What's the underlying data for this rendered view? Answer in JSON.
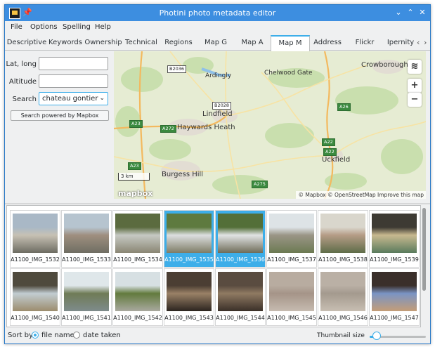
{
  "window": {
    "title": "Photini photo metadata editor",
    "pin_glyph": "📌",
    "minimize": "⌄",
    "maximize": "⌃",
    "close": "✕"
  },
  "menu": [
    "File",
    "Options",
    "Spelling",
    "Help"
  ],
  "tabs": [
    "Descriptive",
    "Keywords",
    "Ownership",
    "Technical",
    "Regions",
    "Map G",
    "Map A",
    "Map M",
    "Address",
    "Flickr",
    "Ipernity"
  ],
  "active_tab": "Map M",
  "tab_scroll": {
    "left": "‹",
    "right": "›"
  },
  "form": {
    "latlong_label": "Lat, long",
    "latlong_value": "",
    "altitude_label": "Altitude",
    "altitude_value": "",
    "search_label": "Search",
    "search_value": "chateau gontier",
    "search_arrow": "⌄",
    "search_button": "Search powered by Mapbox"
  },
  "map": {
    "places": [
      "Crowborough",
      "Ardingly",
      "Chelwood Gate",
      "Lindfield",
      "Haywards Heath",
      "Uckfield",
      "Burgess Hill"
    ],
    "roads": [
      "B2036",
      "B2028",
      "A26",
      "A23",
      "A272",
      "A22",
      "A22",
      "A23",
      "A275"
    ],
    "scale": "3 km",
    "logo": "mapbox",
    "attribution": "© Mapbox © OpenStreetMap Improve this map",
    "zoom_in": "+",
    "zoom_out": "−",
    "layers_icon": "≋"
  },
  "thumbnails": [
    {
      "name": "A1100_IMG_1532",
      "selected": false,
      "c1": "#a9b8c6",
      "c2": "#c7c1b4",
      "c3": "#6d6c62"
    },
    {
      "name": "A1100_IMG_1533",
      "selected": false,
      "c1": "#b6c4cf",
      "c2": "#9f8f7f",
      "c3": "#6f6e63"
    },
    {
      "name": "A1100_IMG_1534",
      "selected": false,
      "c1": "#5b6b3f",
      "c2": "#c6c9c3",
      "c3": "#8a8674"
    },
    {
      "name": "A1100_IMG_1535",
      "selected": true,
      "c1": "#5e7a3f",
      "c2": "#dcdfe0",
      "c3": "#7e7c66"
    },
    {
      "name": "A1100_IMG_1536",
      "selected": true,
      "c1": "#536f38",
      "c2": "#e1e3e4",
      "c3": "#6f6d59"
    },
    {
      "name": "A1100_IMG_1537",
      "selected": false,
      "c1": "#dde3e6",
      "c2": "#9a9586",
      "c3": "#6c7a52"
    },
    {
      "name": "A1100_IMG_1538",
      "selected": false,
      "c1": "#d9d6cc",
      "c2": "#b59c86",
      "c3": "#5f6d49"
    },
    {
      "name": "A1100_IMG_1539",
      "selected": false,
      "c1": "#3d3a33",
      "c2": "#c8b98f",
      "c3": "#5a7b5d"
    },
    {
      "name": "A1100_IMG_1540",
      "selected": false,
      "c1": "#4f4a3d",
      "c2": "#c2cdd2",
      "c3": "#9c8c6d"
    },
    {
      "name": "A1100_IMG_1541",
      "selected": false,
      "c1": "#dfe7ea",
      "c2": "#6f7b56",
      "c3": "#7e8b8c"
    },
    {
      "name": "A1100_IMG_1542",
      "selected": false,
      "c1": "#d7e0e3",
      "c2": "#627a3d",
      "c3": "#a9a99f"
    },
    {
      "name": "A1100_IMG_1543",
      "selected": false,
      "c1": "#4b3e33",
      "c2": "#9a8166",
      "c3": "#2b241f"
    },
    {
      "name": "A1100_IMG_1544",
      "selected": false,
      "c1": "#5a4c40",
      "c2": "#8f7a62",
      "c3": "#3a2f28"
    },
    {
      "name": "A1100_IMG_1545",
      "selected": false,
      "c1": "#b8aca0",
      "c2": "#a59488",
      "c3": "#c6bbb0"
    },
    {
      "name": "A1100_IMG_1546",
      "selected": false,
      "c1": "#bab0a5",
      "c2": "#a49a8e",
      "c3": "#c7beb2"
    },
    {
      "name": "A1100_IMG_1547",
      "selected": false,
      "c1": "#3a2f2a",
      "c2": "#7a94c4",
      "c3": "#c49d77"
    }
  ],
  "bottom": {
    "sort_by": "Sort by",
    "file_name": "file name",
    "date_taken": "date taken",
    "thumbnail_size": "Thumbnail size",
    "thumbnail_size_level": 0.12
  },
  "colors": {
    "accent": "#3daee9",
    "titlebar": "#3d8ee0"
  }
}
